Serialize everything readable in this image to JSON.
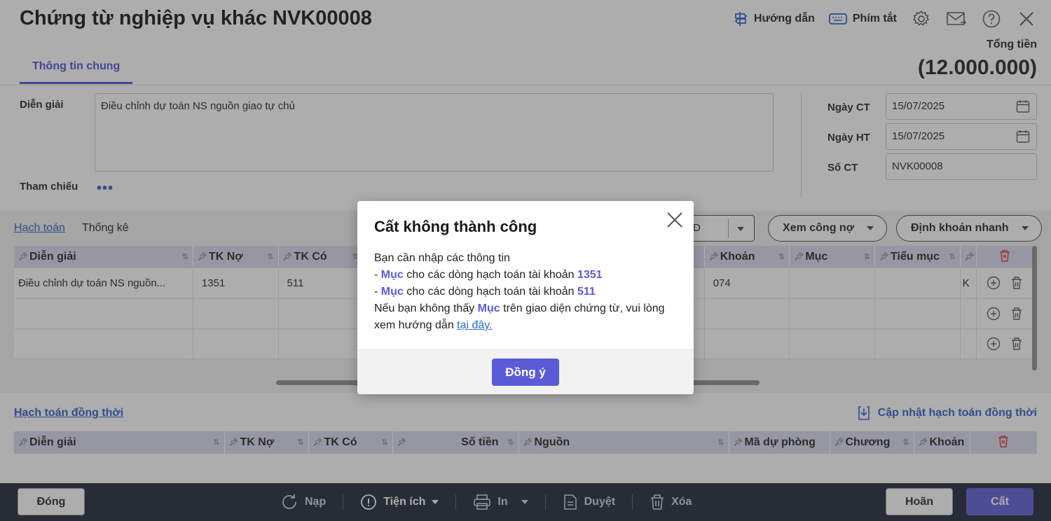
{
  "header": {
    "title": "Chứng từ nghiệp vụ khác NVK00008",
    "guide": "Hướng dẫn",
    "shortcuts": "Phím tắt",
    "total_label": "Tổng tiền",
    "total_value": "(12.000.000)"
  },
  "tabs": {
    "general": "Thông tin chung"
  },
  "info": {
    "description_label": "Diễn giải",
    "description_value": "Điều chỉnh dự toán NS nguồn giao tự chủ",
    "reference_label": "Tham chiếu",
    "reference_more": "•••",
    "date_ct_label": "Ngày CT",
    "date_ct_value": "15/07/2025",
    "date_ht_label": "Ngày HT",
    "date_ht_value": "15/07/2025",
    "so_ct_label": "Số CT",
    "so_ct_value": "NVK00008"
  },
  "entries": {
    "tab_accounting": "Hạch toán",
    "tab_stats": "Thống kê",
    "select_value": "D",
    "view_debt": "Xem công nợ",
    "quick_entry": "Định khoản nhanh",
    "columns": [
      "Diễn giải",
      "TK Nợ",
      "TK Có",
      "Khoản",
      "Mục",
      "Tiểu mục"
    ],
    "rows": [
      {
        "desc": "Điều chỉnh dự toán NS nguồn...",
        "debit": "1351",
        "credit": "511",
        "khoan": "074",
        "muc": "",
        "tieu_muc": "",
        "extra": "K"
      }
    ]
  },
  "simultaneous": {
    "title": "Hạch toán đồng thời",
    "update": "Cập nhật hạch toán đồng thời",
    "columns": [
      "Diễn giải",
      "TK Nợ",
      "TK Có",
      "Số tiền",
      "Nguồn",
      "Mã dự phòng",
      "Chương",
      "Khoản"
    ]
  },
  "footer": {
    "close": "Đóng",
    "reload": "Nạp",
    "utilities": "Tiện ích",
    "print": "In",
    "approve": "Duyệt",
    "delete": "Xóa",
    "cancel": "Hoãn",
    "save": "Cất"
  },
  "dialog": {
    "title": "Cất không thành công",
    "line1": "Bạn cần nhập các thông tin",
    "item_prefix": "- ",
    "item_field": "Mục",
    "item_text": " cho các dòng hạch toán tài khoản ",
    "item1_account": "1351",
    "item2_account": "511",
    "note_a": "Nếu bạn không thấy ",
    "note_field": "Mục",
    "note_b": " trên giao diện chứng từ, vui lòng xem hướng dẫn ",
    "note_link": "tại đây.",
    "ok": "Đồng ý"
  },
  "colors": {
    "accent": "#5b5bd8",
    "link": "#2a5bc8",
    "footer_bg": "#1b2232",
    "grid_header": "#d9daf0"
  }
}
